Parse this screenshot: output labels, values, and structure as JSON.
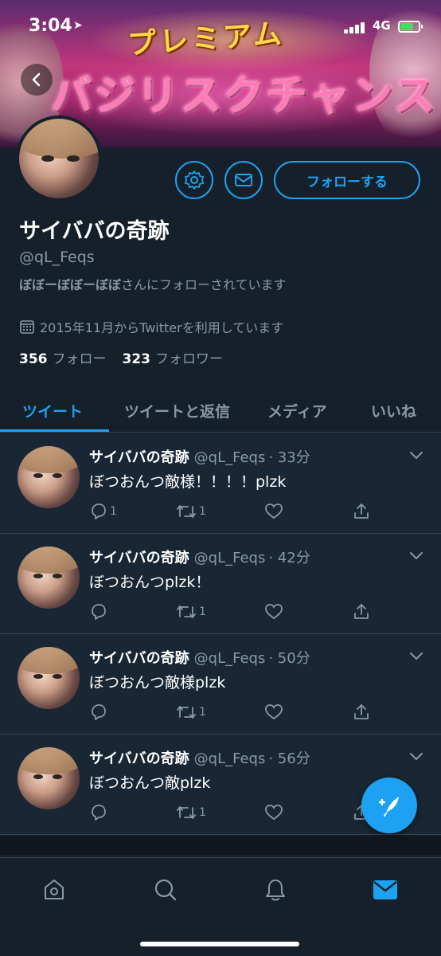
{
  "status_bar": {
    "time": "3:04",
    "network": "4G"
  },
  "banner": {
    "line1": "プレミアム",
    "line2": "バジリスクチャンス"
  },
  "profile": {
    "name": "サイババの奇跡",
    "handle": "@qL_Feqs",
    "followed_by_user": "ぼぼーぼぼーぼぼ",
    "followed_by_suffix": "さんにフォローされています",
    "joined": "2015年11月からTwitterを利用しています",
    "following_count": "356",
    "following_label": "フォロー",
    "followers_count": "323",
    "followers_label": "フォロワー",
    "follow_button": "フォローする"
  },
  "tabs": [
    {
      "label": "ツイート",
      "active": true
    },
    {
      "label": "ツイートと返信",
      "active": false
    },
    {
      "label": "メディア",
      "active": false
    },
    {
      "label": "いいね",
      "active": false
    }
  ],
  "tweets": [
    {
      "name": "サイババの奇跡",
      "handle": "@qL_Feqs",
      "time": "· 33分",
      "text": "ぼつおんつ敵様！！！！plzk",
      "replies": "1",
      "retweets": "1"
    },
    {
      "name": "サイババの奇跡",
      "handle": "@qL_Feqs",
      "time": "· 42分",
      "text": "ぼつおんつplzk！",
      "replies": "",
      "retweets": "1"
    },
    {
      "name": "サイババの奇跡",
      "handle": "@qL_Feqs",
      "time": "· 50分",
      "text": "ぼつおんつ敵様plzk",
      "replies": "",
      "retweets": "1"
    },
    {
      "name": "サイババの奇跡",
      "handle": "@qL_Feqs",
      "time": "· 56分",
      "text": "ぼつおんつ敵plzk",
      "replies": "",
      "retweets": "1"
    }
  ],
  "colors": {
    "accent": "#1da1f2",
    "background": "#15202b",
    "muted": "#8899a6"
  },
  "icons": [
    "back-icon",
    "settings-icon",
    "mail-icon",
    "calendar-icon",
    "reply-icon",
    "retweet-icon",
    "like-icon",
    "share-icon",
    "chevron-down-icon",
    "compose-icon",
    "home-icon",
    "search-icon",
    "notifications-icon",
    "messages-icon"
  ]
}
